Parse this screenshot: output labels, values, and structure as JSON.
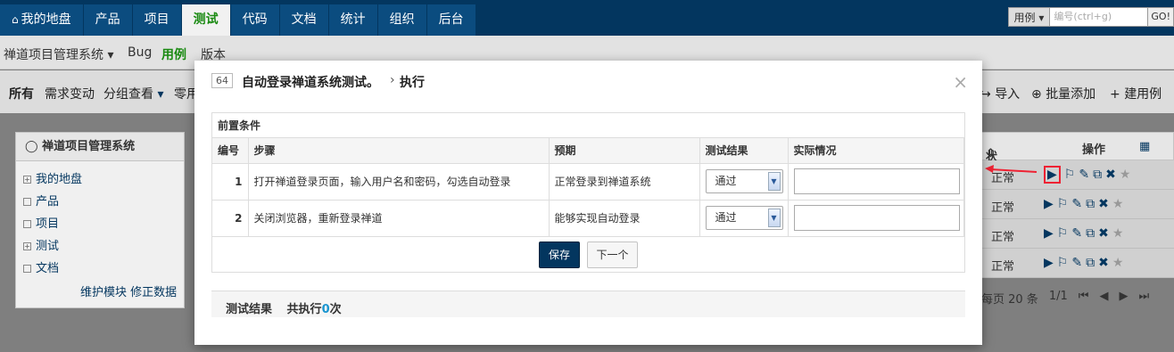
{
  "topnav": {
    "items": [
      "我的地盘",
      "产品",
      "项目",
      "测试",
      "代码",
      "文档",
      "统计",
      "组织",
      "后台"
    ],
    "active_index": 3
  },
  "search": {
    "type_label": "用例",
    "placeholder": "编号(ctrl+g)",
    "go_label": "GO!"
  },
  "subnav": {
    "product": "禅道项目管理系统",
    "bug": "Bug",
    "case": "用例",
    "version": "版本"
  },
  "featurebar": {
    "all": "所有",
    "need_change": "需求变动",
    "group_view": "分组查看",
    "zero_label": "零用",
    "import": "导入",
    "batch_add": "批量添加",
    "create_case": "建用例"
  },
  "sidebar": {
    "title": "禅道项目管理系统",
    "items": [
      {
        "label": "我的地盘",
        "expand": "+"
      },
      {
        "label": "产品",
        "expand": ""
      },
      {
        "label": "项目",
        "expand": ""
      },
      {
        "label": "测试",
        "expand": "+"
      },
      {
        "label": "文档",
        "expand": ""
      }
    ],
    "footer_maintain": "维护模块",
    "footer_fix": "修正数据"
  },
  "list": {
    "status_header": "状态",
    "actions_header": "操作",
    "rows": [
      {
        "status": "正常"
      },
      {
        "status": "正常"
      },
      {
        "status": "正常"
      },
      {
        "status": "正常"
      }
    ],
    "pager": {
      "per_page": "每页 20 条",
      "page": "1/1"
    }
  },
  "modal": {
    "case_id": "64",
    "title": "自动登录禅道系统测试。",
    "action": "执行",
    "precondition_label": "前置条件",
    "columns": [
      "编号",
      "步骤",
      "预期",
      "测试结果",
      "实际情况"
    ],
    "steps": [
      {
        "num": "1",
        "step": "打开禅道登录页面，输入用户名和密码，勾选自动登录",
        "expect": "正常登录到禅道系统",
        "result": "通过",
        "actual": ""
      },
      {
        "num": "2",
        "step": "关闭浏览器，重新登录禅道",
        "expect": "能够实现自动登录",
        "result": "通过",
        "actual": ""
      }
    ],
    "save_label": "保存",
    "next_label": "下一个",
    "results_label": "测试结果",
    "exec_prefix": "共执行",
    "exec_count": "0",
    "exec_suffix": "次"
  },
  "colors": {
    "brand": "#03365f",
    "active_green": "#1a8a12",
    "highlight": "#e23"
  }
}
